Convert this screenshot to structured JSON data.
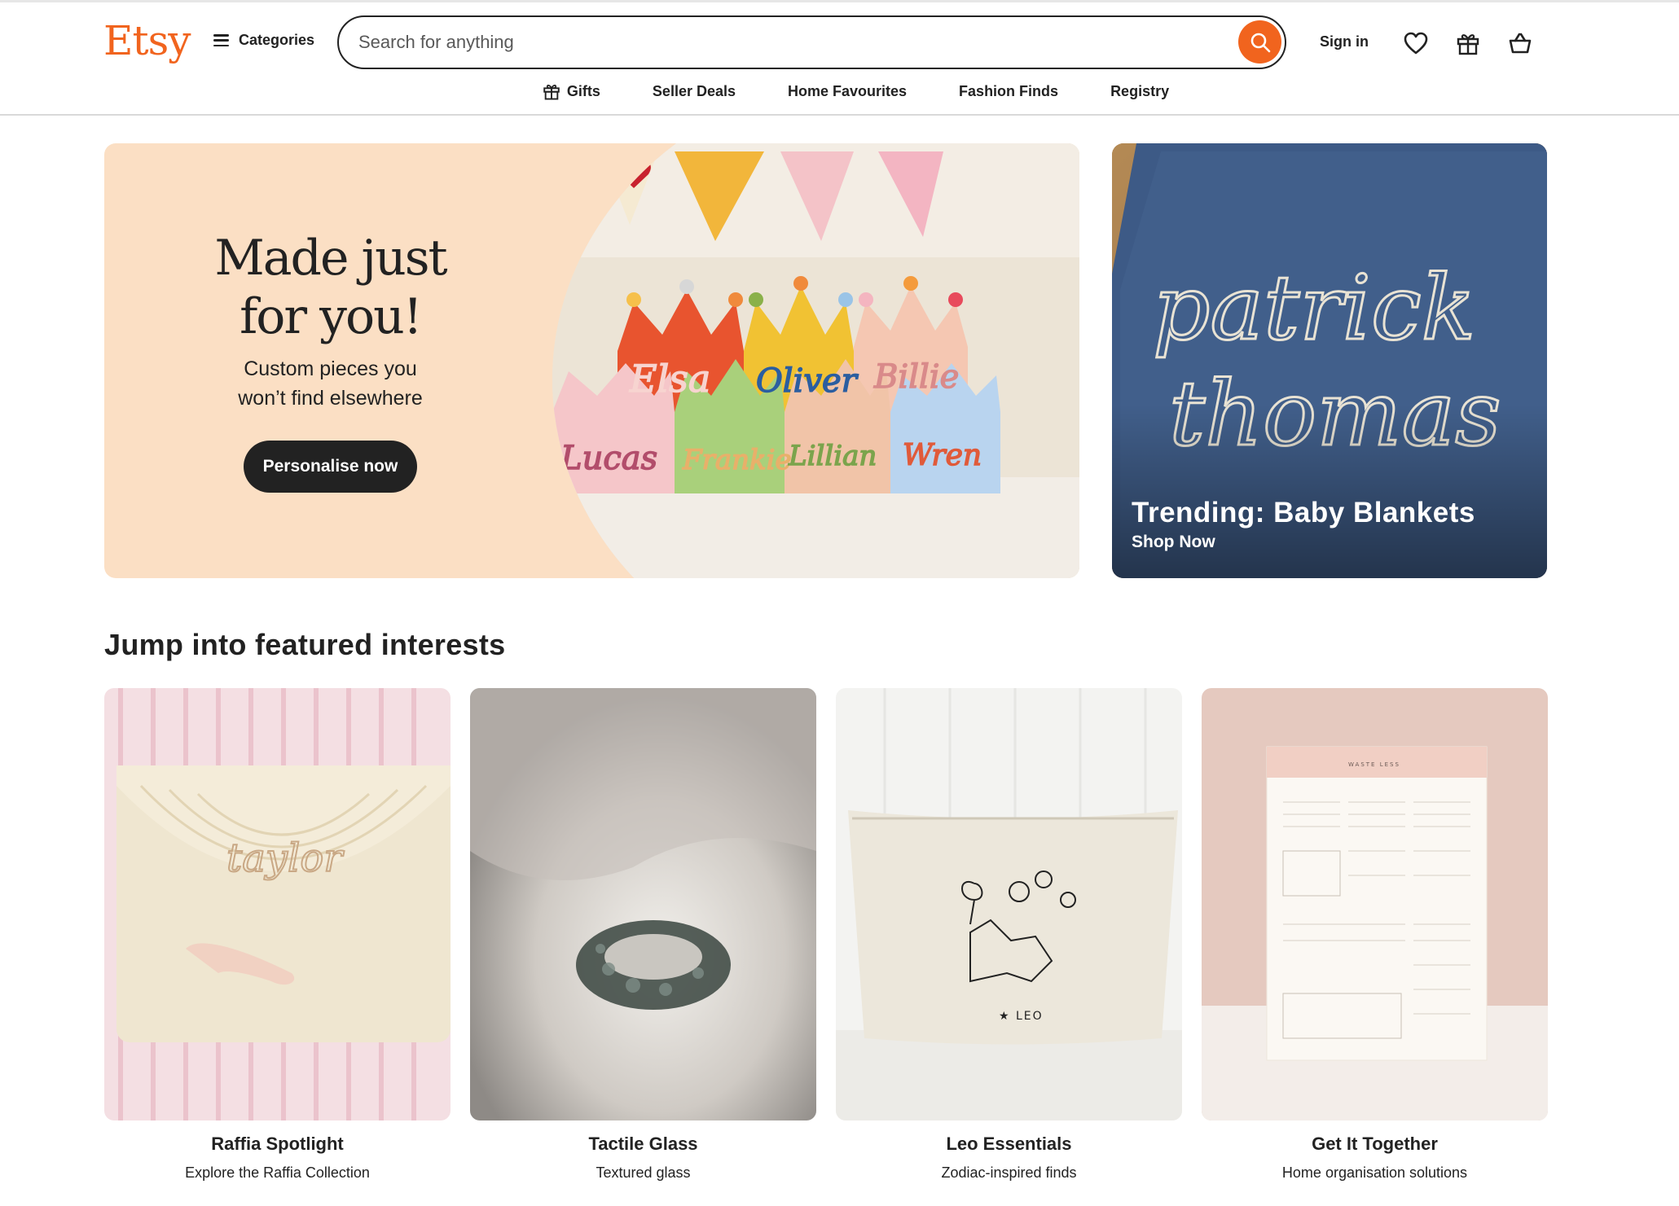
{
  "brand": {
    "logo": "Etsy",
    "accent": "#F1641E"
  },
  "header": {
    "categories_label": "Categories",
    "search_placeholder": "Search for anything",
    "signin_label": "Sign in",
    "icons": [
      "heart-icon",
      "gift-icon",
      "basket-icon"
    ]
  },
  "subnav": [
    {
      "label": "Gifts",
      "icon": "gift-icon"
    },
    {
      "label": "Seller Deals"
    },
    {
      "label": "Home Favourites"
    },
    {
      "label": "Fashion Finds"
    },
    {
      "label": "Registry"
    }
  ],
  "hero": {
    "title_line1": "Made just",
    "title_line2": "for you!",
    "subtitle_line1": "Custom pieces you",
    "subtitle_line2": "won’t find elsewhere",
    "cta": "Personalise now",
    "bg": "#FBDFC4",
    "photo_text": [
      "Elsa",
      "Oliver",
      "Billie",
      "Lucas",
      "Frankie",
      "Lillian",
      "Wren"
    ]
  },
  "side_banner": {
    "title": "Trending: Baby Blankets",
    "link": "Shop Now",
    "photo_text": [
      "patrick",
      "thomas"
    ]
  },
  "featured": {
    "title": "Jump into featured interests",
    "cards": [
      {
        "title": "Raffia Spotlight",
        "subtitle": "Explore the Raffia Collection",
        "photo_text": "taylor"
      },
      {
        "title": "Tactile Glass",
        "subtitle": "Textured glass"
      },
      {
        "title": "Leo Essentials",
        "subtitle": "Zodiac-inspired finds",
        "photo_text": "★ LEO"
      },
      {
        "title": "Get It Together",
        "subtitle": "Home organisation solutions",
        "photo_text": "WASTE LESS"
      }
    ]
  }
}
